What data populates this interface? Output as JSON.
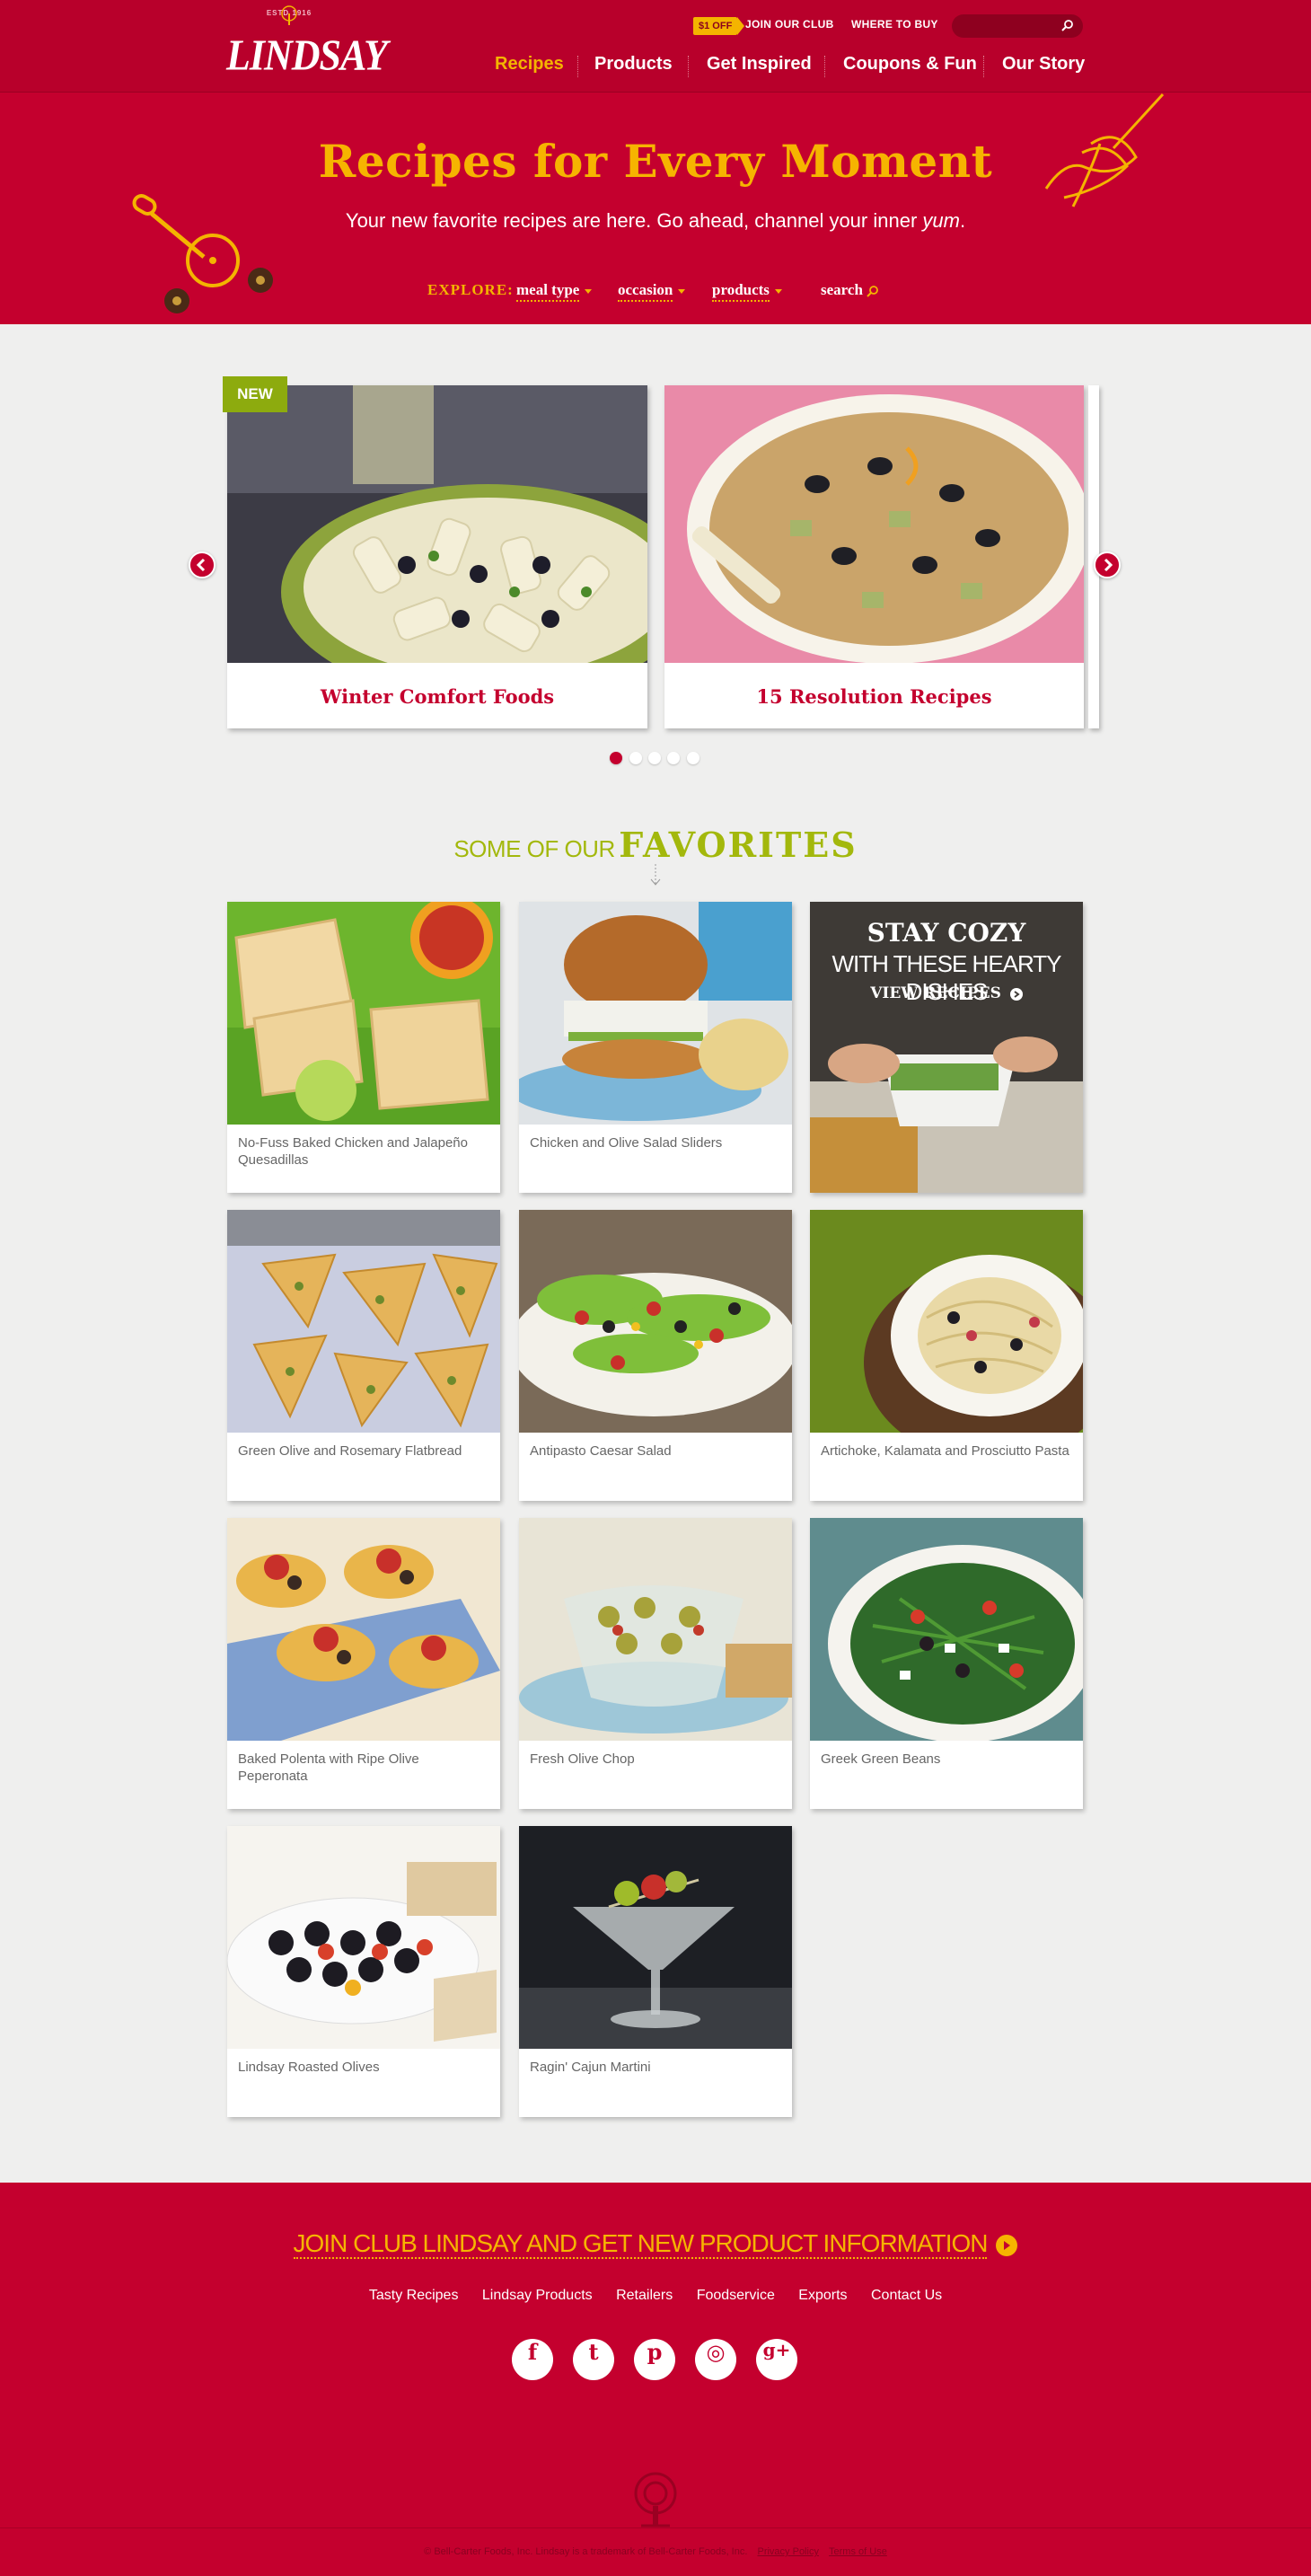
{
  "brand": {
    "logo_text": "LINDSAY",
    "estd": "ESTD 1916",
    "primary_color": "#c4002e",
    "accent_color": "#f4b400",
    "green_color": "#a3b80c"
  },
  "utility": {
    "offer_badge": "$1 OFF",
    "join_club": "JOIN OUR CLUB",
    "where_to_buy": "WHERE TO BUY"
  },
  "nav": {
    "items": [
      {
        "label": "Recipes",
        "active": true
      },
      {
        "label": "Products",
        "active": false
      },
      {
        "label": "Get Inspired",
        "active": false
      },
      {
        "label": "Coupons & Fun",
        "active": false
      },
      {
        "label": "Our Story",
        "active": false
      }
    ]
  },
  "hero": {
    "title": "Recipes for Every Moment",
    "subtitle_main": "Your new favorite recipes are here. Go ahead, channel your inner ",
    "subtitle_em": "yum",
    "subtitle_end": ".",
    "explore_label": "EXPLORE:",
    "filters": [
      "meal type",
      "occasion",
      "products"
    ],
    "search_label": "search"
  },
  "carousel": {
    "new_tag": "NEW",
    "cards": [
      {
        "caption": "Winter Comfort Foods"
      },
      {
        "caption": "15 Resolution Recipes"
      }
    ],
    "dots": 5,
    "active_dot": 1
  },
  "favorites": {
    "heading_small": "SOME OF OUR",
    "heading_big": "FAVORITES",
    "promo": {
      "line1": "STAY COZY",
      "line2": "WITH THESE HEARTY DISHES",
      "line3": "VIEW RECIPES"
    },
    "recipes": [
      "No-Fuss Baked Chicken and Jalapeño Quesadillas",
      "Chicken and Olive Salad Sliders",
      "Green Olive and Rosemary Flatbread",
      "Antipasto Caesar Salad",
      "Artichoke, Kalamata and Prosciutto Pasta",
      "Baked Polenta with Ripe Olive Peperonata",
      "Fresh Olive Chop",
      "Greek Green Beans",
      "Lindsay Roasted Olives",
      "Ragin' Cajun Martini"
    ]
  },
  "footer": {
    "club_cta": "JOIN CLUB LINDSAY AND GET NEW PRODUCT INFORMATION",
    "links": [
      "Tasty Recipes",
      "Lindsay Products",
      "Retailers",
      "Foodservice",
      "Exports",
      "Contact Us"
    ],
    "social": [
      {
        "icon": "facebook-icon",
        "glyph": "f"
      },
      {
        "icon": "twitter-icon",
        "glyph": "t"
      },
      {
        "icon": "pinterest-icon",
        "glyph": "p"
      },
      {
        "icon": "instagram-icon",
        "glyph": "◎"
      },
      {
        "icon": "google-plus-icon",
        "glyph": "g+"
      }
    ],
    "legal": "© Bell-Carter Foods, Inc. Lindsay is a trademark of Bell-Carter Foods, Inc.",
    "privacy": "Privacy Policy",
    "terms": "Terms of Use"
  }
}
